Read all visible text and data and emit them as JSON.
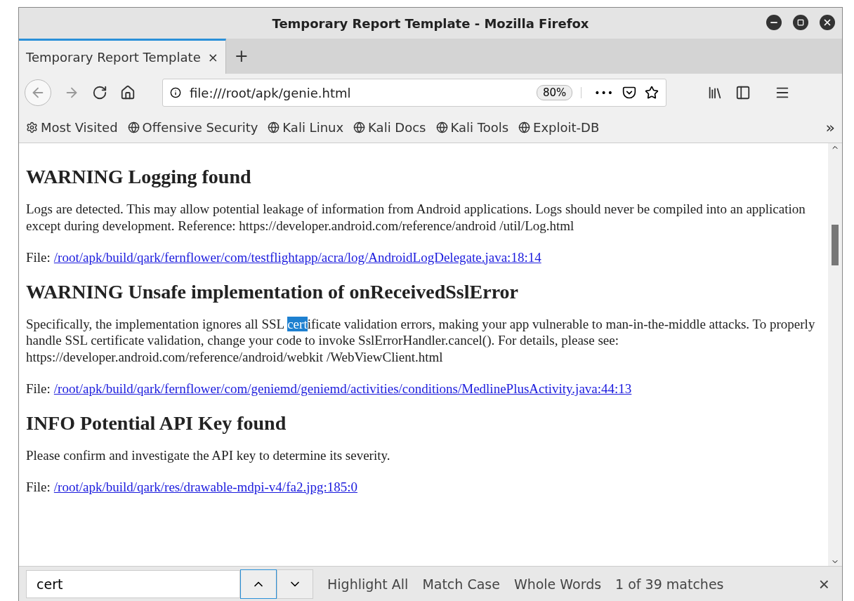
{
  "window": {
    "title": "Temporary Report Template - Mozilla Firefox"
  },
  "tabs": [
    {
      "label": "Temporary Report Template",
      "close": "×",
      "selected": true
    }
  ],
  "new_tab": "+",
  "address_bar": {
    "url": "file:///root/apk/genie.html",
    "zoom": "80%",
    "more": "•••"
  },
  "bookmarks": [
    {
      "label": "Most Visited",
      "kind": "gear"
    },
    {
      "label": "Offensive Security",
      "kind": "globe"
    },
    {
      "label": "Kali Linux",
      "kind": "globe"
    },
    {
      "label": "Kali Docs",
      "kind": "globe"
    },
    {
      "label": "Kali Tools",
      "kind": "globe"
    },
    {
      "label": "Exploit-DB",
      "kind": "globe"
    }
  ],
  "bookmarks_overflow": "»",
  "sections": [
    {
      "heading": "WARNING Logging found",
      "body": {
        "before": "Logs are detected. This may allow potential leakage of information from Android applications. Logs should never be compiled into an application except during development. Reference: https://developer.android.com/reference/android /util/Log.html"
      },
      "file_label": "File:",
      "file_link": "/root/apk/build/qark/fernflower/com/testflightapp/acra/log/AndroidLogDelegate.java:18:14"
    },
    {
      "heading": "WARNING Unsafe implementation of onReceivedSslError",
      "body": {
        "before": "Specifically, the implementation ignores all SSL ",
        "match": "cert",
        "after": "ificate validation errors, making your app vulnerable to man-in-the-middle attacks. To properly handle SSL certificate validation, change your code to invoke SslErrorHandler.cancel(). For details, please see: https://developer.android.com/reference/android/webkit /WebViewClient.html"
      },
      "file_label": "File:",
      "file_link": "/root/apk/build/qark/fernflower/com/geniemd/geniemd/activities/conditions/MedlinePlusActivity.java:44:13"
    },
    {
      "heading": "INFO Potential API Key found",
      "body": {
        "before": "Please confirm and investigate the API key to determine its severity."
      },
      "file_label": "File:",
      "file_link": "/root/apk/build/qark/res/drawable-mdpi-v4/fa2.jpg:185:0"
    }
  ],
  "find_bar": {
    "value": "cert",
    "options": [
      {
        "label": "Highlight All",
        "checked": false
      },
      {
        "label": "Match Case",
        "checked": false
      },
      {
        "label": "Whole Words",
        "checked": false
      }
    ],
    "status": "1 of 39 matches",
    "close": "×"
  }
}
